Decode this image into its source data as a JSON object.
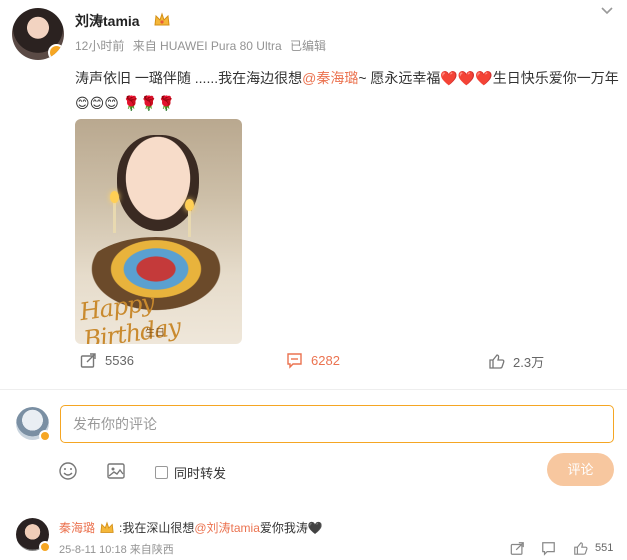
{
  "post": {
    "author": "刘涛tamia",
    "time": "12小时前",
    "source": "来自 HUAWEI Pura 80 Ultra",
    "edited": "已编辑",
    "text_lead": "涛声依旧 一璐伴随 ......我在海边很想",
    "mention": "@秦海璐",
    "text_mid": "~ 愿永远幸福",
    "hearts": "❤️❤️❤️",
    "text_tail": "生日快乐爱你一万年",
    "emoji_tail": "😊😊😊 🌹🌹🌹",
    "image_caption": "Happy Birthday",
    "image_signature": "生日"
  },
  "actions": {
    "share_count": "5536",
    "comment_count": "6282",
    "like_count": "2.3万"
  },
  "composer": {
    "placeholder": "发布你的评论",
    "repost_label": "同时转发",
    "submit_label": "评论"
  },
  "top_comment": {
    "author": "秦海璐",
    "text_lead": ":我在深山很想",
    "mention": "@刘涛tamia",
    "text_tail": "爱你我涛🖤",
    "date": "25-8-11 10:18",
    "location": "来自陕西",
    "likes": "551"
  },
  "colors": {
    "accent": "#eb7350",
    "input_border": "#f5a623",
    "submit_disabled": "#f7c79f",
    "meta_gray": "#939393"
  }
}
